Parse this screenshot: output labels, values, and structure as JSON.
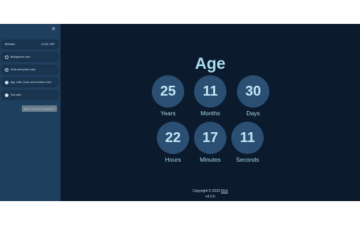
{
  "sidebar": {
    "close_icon": "×",
    "birthdate_label": "Birthdate",
    "birthdate_value": "12-06-1997",
    "options": [
      {
        "label": "Background color",
        "dot_color": "#0b1a2d"
      },
      {
        "label": "Circle and picker color",
        "dot_color": "#2b4f72"
      },
      {
        "label": "Age, units, icons, and numbers color",
        "dot_color": "#a6dced"
      },
      {
        "label": "Text color",
        "dot_color": "#dfe9f2"
      }
    ],
    "reset_label": "RESET COLORS TO DEFAULT"
  },
  "main": {
    "title": "Age",
    "units": [
      {
        "value": "25",
        "label": "Years"
      },
      {
        "value": "11",
        "label": "Months"
      },
      {
        "value": "30",
        "label": "Days"
      },
      {
        "value": "22",
        "label": "Hours"
      },
      {
        "value": "17",
        "label": "Minutes"
      },
      {
        "value": "11",
        "label": "Seconds"
      }
    ]
  },
  "footer": {
    "copyright": "Copyright © 2023",
    "author": "RoS",
    "version": "v4.0.0"
  }
}
